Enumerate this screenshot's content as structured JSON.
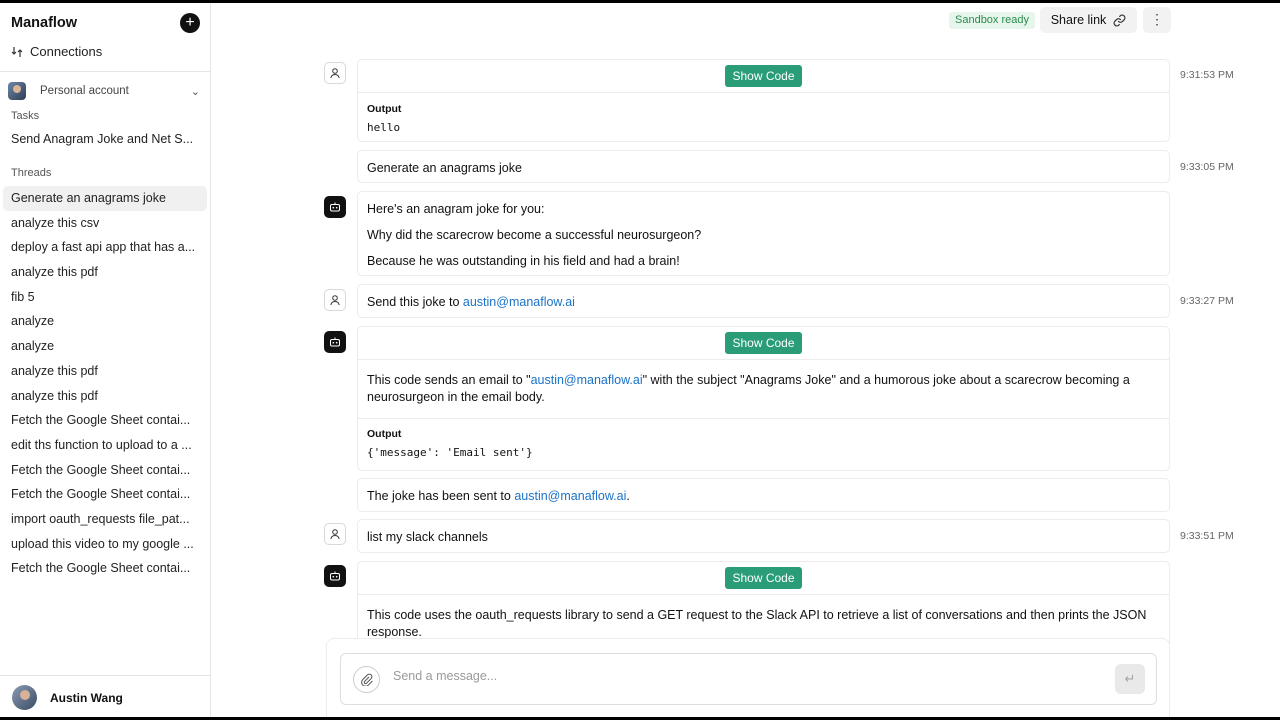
{
  "app": {
    "title": "Manaflow"
  },
  "sidebar": {
    "new_icon": "plus-icon",
    "connections_label": "Connections",
    "account_label": "Personal account",
    "tasks_heading": "Tasks",
    "tasks": [
      {
        "label": "Send Anagram Joke and Net S..."
      }
    ],
    "threads_heading": "Threads",
    "threads": [
      {
        "label": "Generate an anagrams joke",
        "active": true
      },
      {
        "label": "analyze this csv"
      },
      {
        "label": "deploy a fast api app that has a..."
      },
      {
        "label": "analyze this pdf"
      },
      {
        "label": "fib 5"
      },
      {
        "label": "analyze"
      },
      {
        "label": "analyze"
      },
      {
        "label": "analyze this pdf"
      },
      {
        "label": "analyze this pdf"
      },
      {
        "label": "Fetch the Google Sheet contai..."
      },
      {
        "label": "edit ths function to upload to a ..."
      },
      {
        "label": "Fetch the Google Sheet contai..."
      },
      {
        "label": "Fetch the Google Sheet contai..."
      },
      {
        "label": "import oauth_requests file_pat..."
      },
      {
        "label": "upload this video to my google ..."
      },
      {
        "label": "Fetch the Google Sheet contai..."
      }
    ],
    "user_name": "Austin Wang"
  },
  "header": {
    "status": "Sandbox ready",
    "share_label": "Share link",
    "more_icon": "more-vertical-icon"
  },
  "chat": {
    "show_code_label": "Show Code",
    "output_label": "Output",
    "m1": {
      "time": "9:31:53 PM",
      "output": "hello"
    },
    "m2": {
      "time": "9:33:05 PM",
      "text": "Generate an anagrams joke"
    },
    "m3": {
      "line1": "Here's an anagram joke for you:",
      "line2": "Why did the scarecrow become a successful neurosurgeon?",
      "line3": "Because he was outstanding in his field and had a brain!"
    },
    "m4": {
      "time": "9:33:27 PM",
      "text": "Send this joke to ",
      "email": "austin@manaflow.ai"
    },
    "m5": {
      "desc_pre": "This code sends an email to \"",
      "email": "austin@manaflow.ai",
      "desc_post": "\" with the subject \"Anagrams Joke\" and a humorous joke about a scarecrow becoming a neurosurgeon in the email body.",
      "output": "{'message': 'Email sent'}"
    },
    "m6": {
      "text_pre": "The joke has been sent to ",
      "email": "austin@manaflow.ai",
      "text_post": "."
    },
    "m7": {
      "time": "9:33:51 PM",
      "text": "list my slack channels"
    },
    "m8": {
      "desc": "This code uses the oauth_requests library to send a GET request to the Slack API to retrieve a list of conversations and then prints the JSON response."
    }
  },
  "composer": {
    "placeholder": "Send a message...",
    "attach_icon": "paperclip-icon",
    "send_icon": "enter-icon",
    "send_glyph": "↵"
  },
  "colors": {
    "accent": "#2a9d78",
    "link": "#1a73c8",
    "status_bg": "#e7f6ec",
    "status_text": "#2c8a4b"
  }
}
